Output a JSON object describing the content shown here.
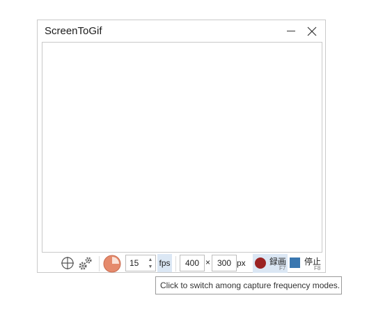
{
  "window": {
    "title": "ScreenToGif",
    "minimize_icon": "minimize-icon",
    "close_icon": "close-icon"
  },
  "toolbar": {
    "snap_icon": "crosshair-icon",
    "options_icon": "gear-icon",
    "frequency_icon": "frequency-pie-icon",
    "fps_value": "15",
    "fps_label": "fps",
    "width_value": "400",
    "times_sign": "×",
    "height_value": "300",
    "size_unit": "px",
    "record_label": "録画",
    "record_shortcut": "F7",
    "stop_label": "停止",
    "stop_shortcut": "F8"
  },
  "tooltip": {
    "text": "Click to switch among capture frequency modes."
  },
  "colors": {
    "record_dot": "#9b2323",
    "stop_square": "#3a77b0",
    "highlight": "#dbe7f4",
    "frequency_pie": "#e58a6c"
  }
}
